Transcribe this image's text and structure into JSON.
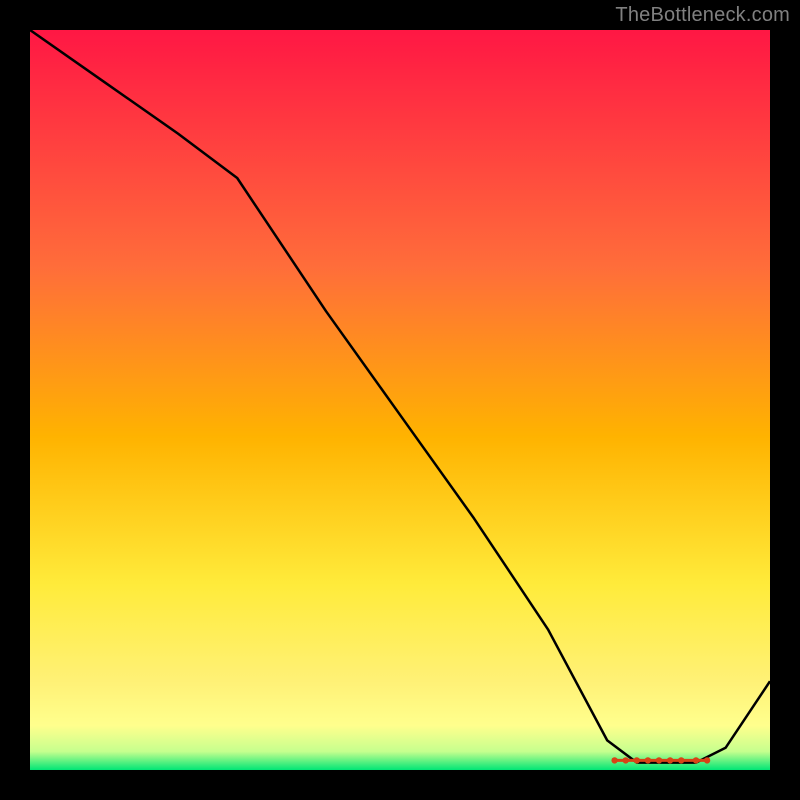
{
  "watermark": "TheBottleneck.com",
  "chart_data": {
    "type": "line",
    "title": "",
    "xlabel": "",
    "ylabel": "",
    "xlim": [
      0,
      100
    ],
    "ylim": [
      0,
      100
    ],
    "grid": false,
    "legend": false,
    "background_gradient": {
      "top_color": "#ff1744",
      "mid_upper_color": "#ff9800",
      "mid_lower_color": "#ffeb3b",
      "lower_band_color": "#ffff8d",
      "bottom_color": "#00e676"
    },
    "series": [
      {
        "name": "curve",
        "color": "#000000",
        "x": [
          0,
          10,
          20,
          28,
          40,
          50,
          60,
          70,
          78,
          82,
          86,
          90,
          94,
          100
        ],
        "y": [
          100,
          93,
          86,
          80,
          62,
          48,
          34,
          19,
          4,
          1,
          1,
          1,
          3,
          12
        ]
      }
    ],
    "markers": {
      "name": "flat-segment-dots",
      "color": "#d84315",
      "x": [
        79,
        80.5,
        82,
        83.5,
        85,
        86.5,
        88,
        90,
        91.5
      ],
      "y": [
        1.3,
        1.3,
        1.3,
        1.3,
        1.3,
        1.3,
        1.3,
        1.3,
        1.3
      ]
    }
  }
}
